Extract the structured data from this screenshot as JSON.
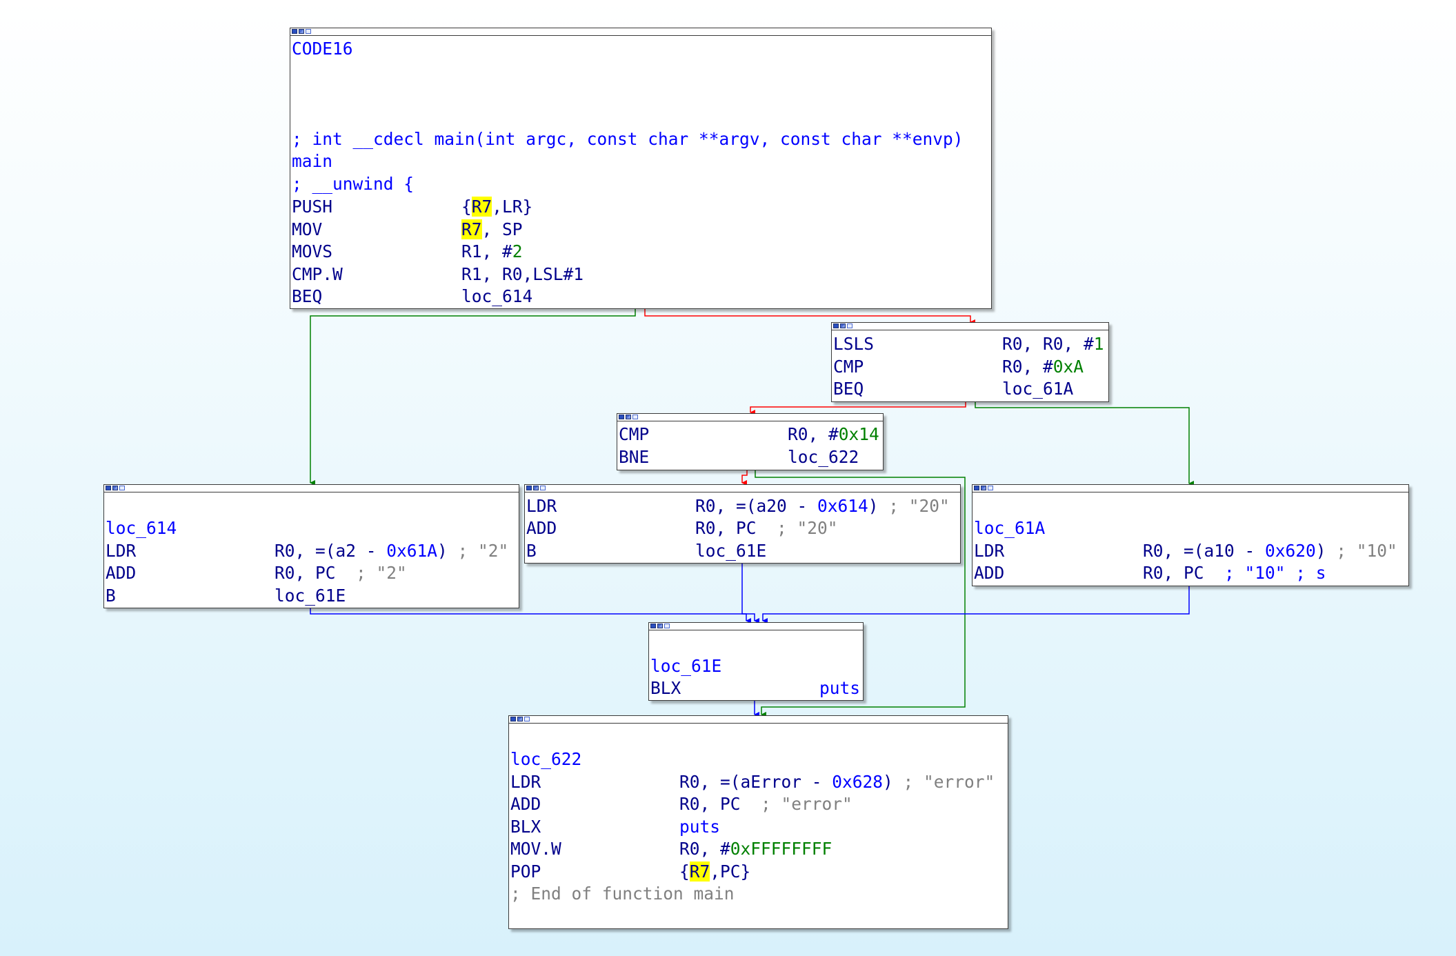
{
  "colors": {
    "background_top": "#ffffff",
    "background_bottom": "#d8f1fb",
    "edge_true": "#008000",
    "edge_false": "#ff0000",
    "edge_unconditional": "#0000ff",
    "register_highlight": "#ffff00"
  },
  "blocks": {
    "main": {
      "segment": "CODE16",
      "prototype": "; int __cdecl main(int argc, const char **argv, const char **envp)",
      "label": "main",
      "unwind": "; __unwind {",
      "push_mnem": "PUSH",
      "push_op_a": "{",
      "push_op_reg": "R7",
      "push_op_b": ",LR}",
      "mov_mnem": "MOV",
      "mov_op_reg": "R7",
      "mov_op_b": ", SP",
      "movs_mnem": "MOVS",
      "movs_op_a": "R1, #",
      "movs_op_num": "2",
      "cmp_mnem": "CMP.W",
      "cmp_op": "R1, R0,LSL#1",
      "beq_mnem": "BEQ",
      "beq_op": "loc_614"
    },
    "lsls": {
      "lsls_mnem": "LSLS",
      "lsls_op_a": "R0, R0, #",
      "lsls_op_num": "1",
      "cmp_mnem": "CMP",
      "cmp_op_a": "R0, #",
      "cmp_op_num": "0xA",
      "beq_mnem": "BEQ",
      "beq_op": "loc_61A"
    },
    "cmp14": {
      "cmp_mnem": "CMP",
      "cmp_op_a": "R0, #",
      "cmp_op_num": "0x14",
      "bne_mnem": "BNE",
      "bne_op": "loc_622"
    },
    "loc_614": {
      "label": "loc_614",
      "ldr_mnem": "LDR",
      "ldr_op_a": "R0, =(a2 - ",
      "ldr_op_num": "0x61A",
      "ldr_op_b": ")",
      "ldr_comment": " ; \"2\"",
      "add_mnem": "ADD",
      "add_op": "R0, PC",
      "add_comment": "  ; \"2\"",
      "b_mnem": "B",
      "b_op": "loc_61E"
    },
    "ldr20": {
      "ldr_mnem": "LDR",
      "ldr_op_a": "R0, =(a20 - ",
      "ldr_op_num": "0x614",
      "ldr_op_b": ")",
      "ldr_comment": " ; \"20\"",
      "add_mnem": "ADD",
      "add_op": "R0, PC",
      "add_comment": "  ; \"20\"",
      "b_mnem": "B",
      "b_op": "loc_61E"
    },
    "loc_61A": {
      "label": "loc_61A",
      "ldr_mnem": "LDR",
      "ldr_op_a": "R0, =(a10 - ",
      "ldr_op_num": "0x620",
      "ldr_op_b": ")",
      "ldr_comment": " ; \"10\"",
      "add_mnem": "ADD",
      "add_op": "R0, PC",
      "add_comment": "  ; \"10\"",
      "add_comment_b": " ; s"
    },
    "loc_61E": {
      "label": "loc_61E",
      "blx_mnem": "BLX",
      "blx_op": "puts"
    },
    "loc_622": {
      "label": "loc_622",
      "ldr_mnem": "LDR",
      "ldr_op_a": "R0, =(aError - ",
      "ldr_op_num": "0x628",
      "ldr_op_b": ")",
      "ldr_comment": " ; \"error\"",
      "add_mnem": "ADD",
      "add_op": "R0, PC",
      "add_comment": "  ; \"error\"",
      "blx_mnem": "BLX",
      "blx_op": "puts",
      "movw_mnem": "MOV.W",
      "movw_op_a": "R0, #",
      "movw_op_num": "0xFFFFFFFF",
      "pop_mnem": "POP",
      "pop_op_a": "{",
      "pop_op_reg": "R7",
      "pop_op_b": ",PC}",
      "end_comment": "; End of function main"
    }
  }
}
